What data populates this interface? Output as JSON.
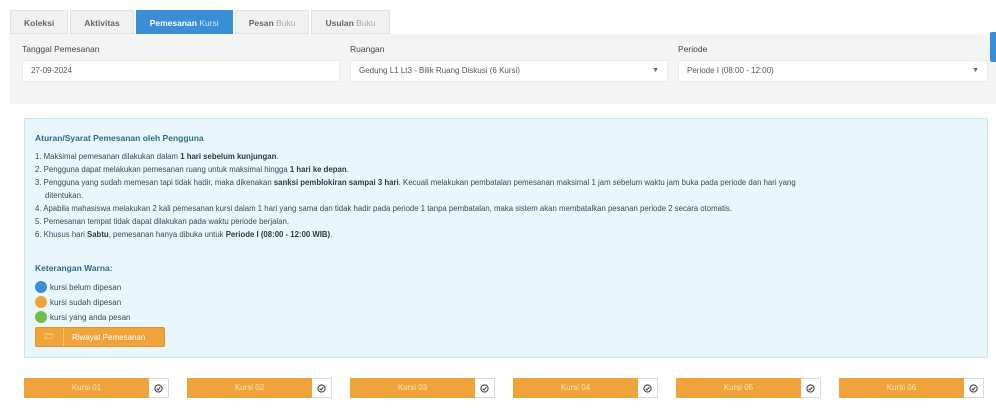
{
  "tabs": [
    {
      "bold": "Koleksi",
      "light": ""
    },
    {
      "bold": "Aktivitas",
      "light": ""
    },
    {
      "bold": "Pemesanan",
      "light": "Kursi"
    },
    {
      "bold": "Pesan",
      "light": "Buku"
    },
    {
      "bold": "Usulan",
      "light": "Buku"
    }
  ],
  "form": {
    "date_label": "Tanggal Pemesanan",
    "date_value": "27-09-2024",
    "room_label": "Ruangan",
    "room_value": "Gedung L1 Lt3 - Bilik Ruang Diskusi (6 Kursi)",
    "period_label": "Periode",
    "period_value": "Periode I (08:00 - 12:00)"
  },
  "rules": {
    "title": "Aturan/Syarat Pemesanan oleh Pengguna",
    "r1a": "1. Maksimal pemesanan dilakukan dalam ",
    "r1b": "1 hari sebelum kunjungan",
    "r1c": ".",
    "r2a": "2. Pengguna dapat melakukan pemesanan ruang untuk maksimal hingga ",
    "r2b": "1 hari ke depan",
    "r2c": ".",
    "r3a": "3. Pengguna yang sudah memesan tapi tidak hadir, maka dikenakan ",
    "r3b": "sanksi pemblokiran sampai 3 hari",
    "r3c": ". Kecuali melakukan pembatalan pemesanan maksimal 1 jam sebelum waktu jam buka pada periode dan hari yang",
    "r3d": "ditentukan.",
    "r4": "4. Apabila mahasiswa melakukan 2 kali pemesanan kursi dalam 1 hari yang sama dan tidak hadir pada periode 1 tanpa pembatalan, maka sistem akan membatalkan pesanan periode 2 secara otomatis.",
    "r5": "5. Pemesanan tempat tidak dapat dilakukan pada waktu periode berjalan.",
    "r6a": "6. Khusus hari ",
    "r6b": "Sabtu",
    "r6c": ", pemesanan hanya dibuka untuk ",
    "r6d": "Periode I (08:00 - 12:00 WIB)",
    "r6e": "."
  },
  "legend": {
    "title": "Keterangan Warna:",
    "items": [
      {
        "label": "kursi belum dipesan",
        "color": "#3a8ed6"
      },
      {
        "label": "kursi sudah dipesan",
        "color": "#f0a33a"
      },
      {
        "label": "kursi yang anda pesan",
        "color": "#6cc04a"
      }
    ]
  },
  "history_button": "Riwayat Pemesanan",
  "seats": [
    "Kursi 01",
    "Kursi 02",
    "Kursi 03",
    "Kursi 04",
    "Kursi 05",
    "Kursi 06"
  ],
  "colors": {
    "accent": "#3a8ed6",
    "seat": "#f0a33a",
    "info_bg": "#e9f7fc"
  }
}
